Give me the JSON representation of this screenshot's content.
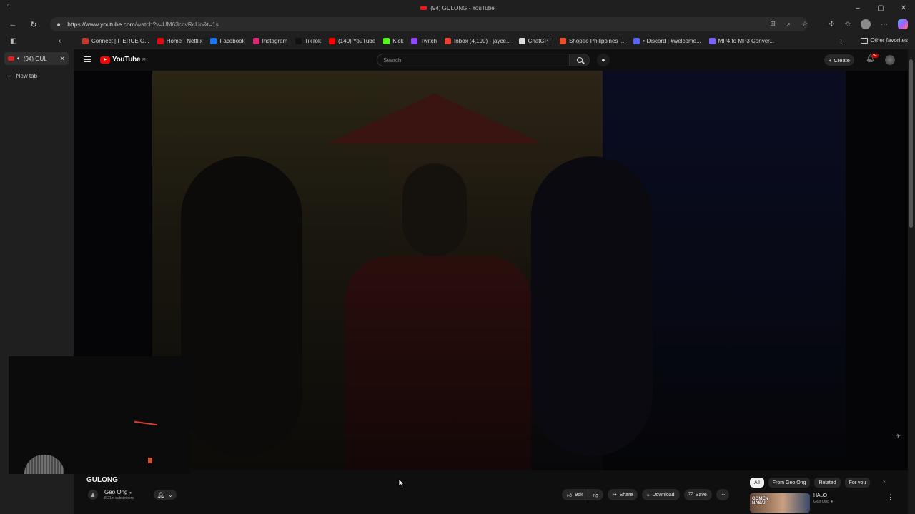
{
  "browser": {
    "window_title": "(94) GULONG - YouTube",
    "url_domain": "https://www.youtube.com",
    "url_path": "/watch?v=UM63ccvRcUo&t=1s",
    "tab_label": "(94) GUL",
    "new_tab_label": "New tab",
    "other_favorites": "Other favorites",
    "favorites": [
      {
        "label": "Connect | FIERCE G...",
        "color": "#c0392b"
      },
      {
        "label": "Home - Netflix",
        "color": "#e50914"
      },
      {
        "label": "Facebook",
        "color": "#1877f2"
      },
      {
        "label": "Instagram",
        "color": "#d62976"
      },
      {
        "label": "TikTok",
        "color": "#111111"
      },
      {
        "label": "(140) YouTube",
        "color": "#ff0000"
      },
      {
        "label": "Kick",
        "color": "#53fc18"
      },
      {
        "label": "Twitch",
        "color": "#9146ff"
      },
      {
        "label": "Inbox (4,190) - jayce...",
        "color": "#ea4335"
      },
      {
        "label": "ChatGPT",
        "color": "#dddddd"
      },
      {
        "label": "Shopee Philippines |...",
        "color": "#ee4d2d"
      },
      {
        "label": "• Discord | #welcome...",
        "color": "#5865f2"
      },
      {
        "label": "MP4 to MP3 Conver...",
        "color": "#7b61ff"
      }
    ]
  },
  "youtube": {
    "logo_text": "YouTube",
    "logo_region": "PH",
    "search_placeholder": "Search",
    "create_label": "Create",
    "notification_count": "9+"
  },
  "video": {
    "title": "GULONG",
    "channel": "Geo Ong",
    "subscribers": "8.21m subscribers",
    "likes": "95k",
    "share_label": "Share",
    "download_label": "Download",
    "save_label": "Save"
  },
  "filters": [
    "All",
    "From Geo Ong",
    "Related",
    "For you"
  ],
  "recommended": {
    "thumb_text": "GOMEN\nNASAI",
    "title": "HALO",
    "channel": "Geo Ong"
  }
}
